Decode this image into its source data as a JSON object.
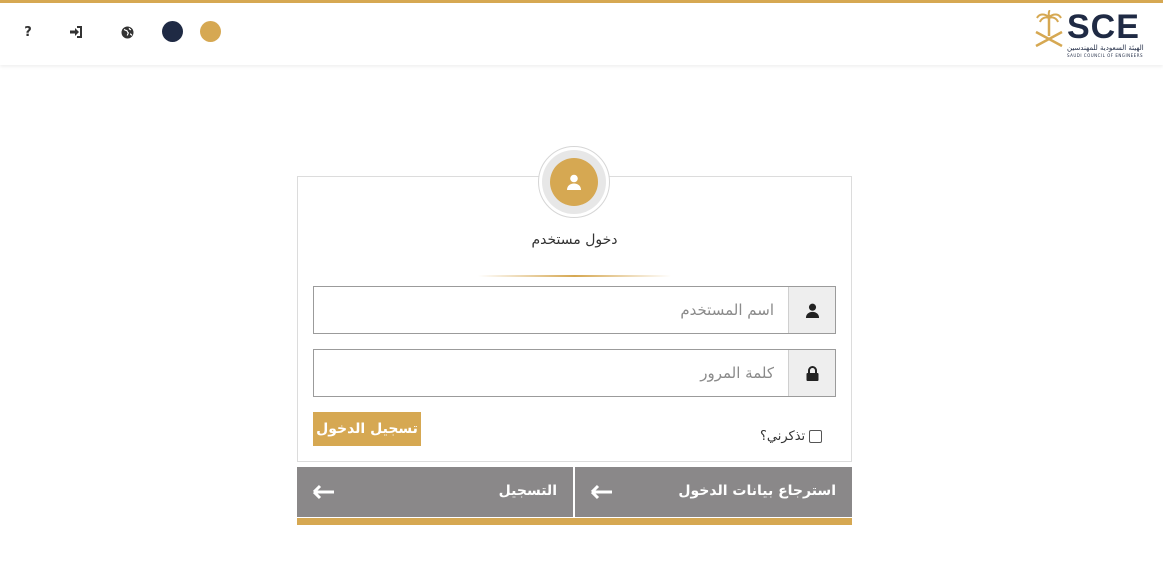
{
  "header": {
    "help_label": "?",
    "logo": {
      "wordmark": "SCE",
      "subtitle_ar": "الهيئة السعودية للمهندسين",
      "subtitle_en": "SAUDI COUNCIL OF ENGINEERS"
    },
    "theme_colors": [
      "#1f2a44",
      "#d6a852"
    ]
  },
  "login": {
    "title": "دخول مستخدم",
    "username_placeholder": "اسم المستخدم",
    "password_placeholder": "كلمة المرور",
    "remember_label": "تذكرني؟",
    "submit_label": "تسجيل الدخول"
  },
  "actions": {
    "recover_label": "استرجاع بيانات الدخول",
    "register_label": "التسجيل"
  },
  "colors": {
    "accent": "#d6a852",
    "navy": "#1f2a44",
    "action_bg": "#8a8889"
  },
  "icons": [
    "question-icon",
    "sign-in-icon",
    "globe-icon",
    "user-icon",
    "lock-icon",
    "arrow-left-icon"
  ]
}
